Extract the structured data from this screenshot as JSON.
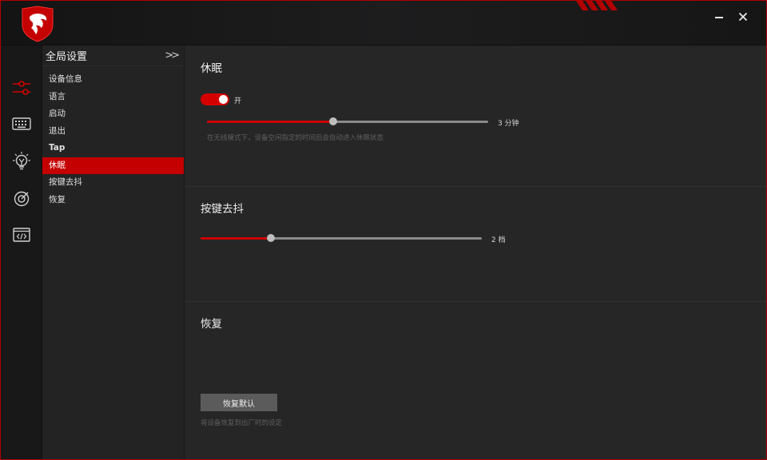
{
  "window": {
    "minimize_icon": "minimize-icon",
    "close_icon": "close-icon",
    "accent": "#c40000"
  },
  "rail": {
    "items": [
      {
        "icon": "sliders-icon",
        "active": true
      },
      {
        "icon": "keyboard-icon",
        "active": false
      },
      {
        "icon": "lightbulb-icon",
        "active": false
      },
      {
        "icon": "target-icon",
        "active": false
      },
      {
        "icon": "code-window-icon",
        "active": false
      }
    ]
  },
  "submenu": {
    "title": "全局设置",
    "collapse_glyph": "»",
    "items": [
      {
        "label": "设备信息"
      },
      {
        "label": "语言"
      },
      {
        "label": "启动"
      },
      {
        "label": "退出"
      },
      {
        "label": "Tap"
      },
      {
        "label": "休眠"
      },
      {
        "label": "按键去抖"
      },
      {
        "label": "恢复"
      }
    ],
    "active_index": 5
  },
  "sleep": {
    "title": "休眠",
    "toggle_on": true,
    "toggle_label": "开",
    "slider_fraction": 0.45,
    "value_label": "3 分钟",
    "hint": "在无线模式下，设备空闲指定的时间后会自动进入休眠状态"
  },
  "debounce": {
    "title": "按键去抖",
    "slider_fraction": 0.25,
    "value_label": "2 档"
  },
  "restore": {
    "title": "恢复",
    "button_label": "恢复默认",
    "hint": "将设备恢复到出厂时的设定"
  }
}
